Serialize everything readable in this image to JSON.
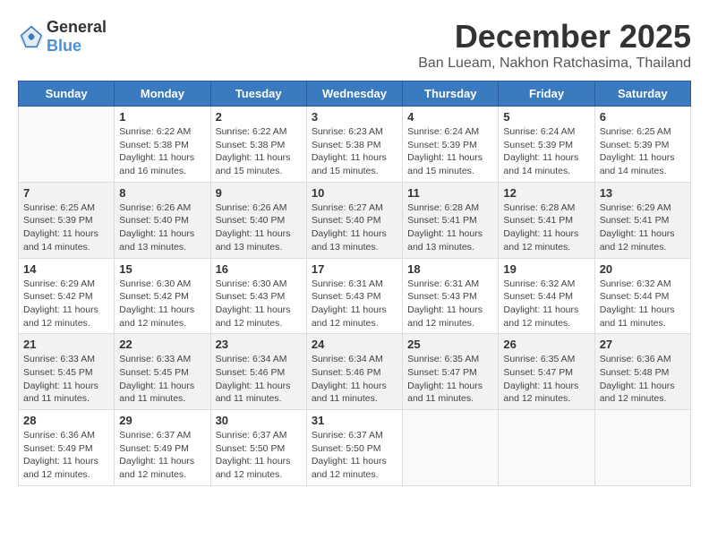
{
  "logo": {
    "text_general": "General",
    "text_blue": "Blue"
  },
  "title": {
    "month": "December 2025",
    "location": "Ban Lueam, Nakhon Ratchasima, Thailand"
  },
  "headers": [
    "Sunday",
    "Monday",
    "Tuesday",
    "Wednesday",
    "Thursday",
    "Friday",
    "Saturday"
  ],
  "weeks": [
    {
      "shade": "white",
      "days": [
        {
          "num": "",
          "detail": ""
        },
        {
          "num": "1",
          "detail": "Sunrise: 6:22 AM\nSunset: 5:38 PM\nDaylight: 11 hours\nand 16 minutes."
        },
        {
          "num": "2",
          "detail": "Sunrise: 6:22 AM\nSunset: 5:38 PM\nDaylight: 11 hours\nand 15 minutes."
        },
        {
          "num": "3",
          "detail": "Sunrise: 6:23 AM\nSunset: 5:38 PM\nDaylight: 11 hours\nand 15 minutes."
        },
        {
          "num": "4",
          "detail": "Sunrise: 6:24 AM\nSunset: 5:39 PM\nDaylight: 11 hours\nand 15 minutes."
        },
        {
          "num": "5",
          "detail": "Sunrise: 6:24 AM\nSunset: 5:39 PM\nDaylight: 11 hours\nand 14 minutes."
        },
        {
          "num": "6",
          "detail": "Sunrise: 6:25 AM\nSunset: 5:39 PM\nDaylight: 11 hours\nand 14 minutes."
        }
      ]
    },
    {
      "shade": "shade",
      "days": [
        {
          "num": "7",
          "detail": "Sunrise: 6:25 AM\nSunset: 5:39 PM\nDaylight: 11 hours\nand 14 minutes."
        },
        {
          "num": "8",
          "detail": "Sunrise: 6:26 AM\nSunset: 5:40 PM\nDaylight: 11 hours\nand 13 minutes."
        },
        {
          "num": "9",
          "detail": "Sunrise: 6:26 AM\nSunset: 5:40 PM\nDaylight: 11 hours\nand 13 minutes."
        },
        {
          "num": "10",
          "detail": "Sunrise: 6:27 AM\nSunset: 5:40 PM\nDaylight: 11 hours\nand 13 minutes."
        },
        {
          "num": "11",
          "detail": "Sunrise: 6:28 AM\nSunset: 5:41 PM\nDaylight: 11 hours\nand 13 minutes."
        },
        {
          "num": "12",
          "detail": "Sunrise: 6:28 AM\nSunset: 5:41 PM\nDaylight: 11 hours\nand 12 minutes."
        },
        {
          "num": "13",
          "detail": "Sunrise: 6:29 AM\nSunset: 5:41 PM\nDaylight: 11 hours\nand 12 minutes."
        }
      ]
    },
    {
      "shade": "white",
      "days": [
        {
          "num": "14",
          "detail": "Sunrise: 6:29 AM\nSunset: 5:42 PM\nDaylight: 11 hours\nand 12 minutes."
        },
        {
          "num": "15",
          "detail": "Sunrise: 6:30 AM\nSunset: 5:42 PM\nDaylight: 11 hours\nand 12 minutes."
        },
        {
          "num": "16",
          "detail": "Sunrise: 6:30 AM\nSunset: 5:43 PM\nDaylight: 11 hours\nand 12 minutes."
        },
        {
          "num": "17",
          "detail": "Sunrise: 6:31 AM\nSunset: 5:43 PM\nDaylight: 11 hours\nand 12 minutes."
        },
        {
          "num": "18",
          "detail": "Sunrise: 6:31 AM\nSunset: 5:43 PM\nDaylight: 11 hours\nand 12 minutes."
        },
        {
          "num": "19",
          "detail": "Sunrise: 6:32 AM\nSunset: 5:44 PM\nDaylight: 11 hours\nand 12 minutes."
        },
        {
          "num": "20",
          "detail": "Sunrise: 6:32 AM\nSunset: 5:44 PM\nDaylight: 11 hours\nand 11 minutes."
        }
      ]
    },
    {
      "shade": "shade",
      "days": [
        {
          "num": "21",
          "detail": "Sunrise: 6:33 AM\nSunset: 5:45 PM\nDaylight: 11 hours\nand 11 minutes."
        },
        {
          "num": "22",
          "detail": "Sunrise: 6:33 AM\nSunset: 5:45 PM\nDaylight: 11 hours\nand 11 minutes."
        },
        {
          "num": "23",
          "detail": "Sunrise: 6:34 AM\nSunset: 5:46 PM\nDaylight: 11 hours\nand 11 minutes."
        },
        {
          "num": "24",
          "detail": "Sunrise: 6:34 AM\nSunset: 5:46 PM\nDaylight: 11 hours\nand 11 minutes."
        },
        {
          "num": "25",
          "detail": "Sunrise: 6:35 AM\nSunset: 5:47 PM\nDaylight: 11 hours\nand 11 minutes."
        },
        {
          "num": "26",
          "detail": "Sunrise: 6:35 AM\nSunset: 5:47 PM\nDaylight: 11 hours\nand 12 minutes."
        },
        {
          "num": "27",
          "detail": "Sunrise: 6:36 AM\nSunset: 5:48 PM\nDaylight: 11 hours\nand 12 minutes."
        }
      ]
    },
    {
      "shade": "white",
      "days": [
        {
          "num": "28",
          "detail": "Sunrise: 6:36 AM\nSunset: 5:49 PM\nDaylight: 11 hours\nand 12 minutes."
        },
        {
          "num": "29",
          "detail": "Sunrise: 6:37 AM\nSunset: 5:49 PM\nDaylight: 11 hours\nand 12 minutes."
        },
        {
          "num": "30",
          "detail": "Sunrise: 6:37 AM\nSunset: 5:50 PM\nDaylight: 11 hours\nand 12 minutes."
        },
        {
          "num": "31",
          "detail": "Sunrise: 6:37 AM\nSunset: 5:50 PM\nDaylight: 11 hours\nand 12 minutes."
        },
        {
          "num": "",
          "detail": ""
        },
        {
          "num": "",
          "detail": ""
        },
        {
          "num": "",
          "detail": ""
        }
      ]
    }
  ]
}
